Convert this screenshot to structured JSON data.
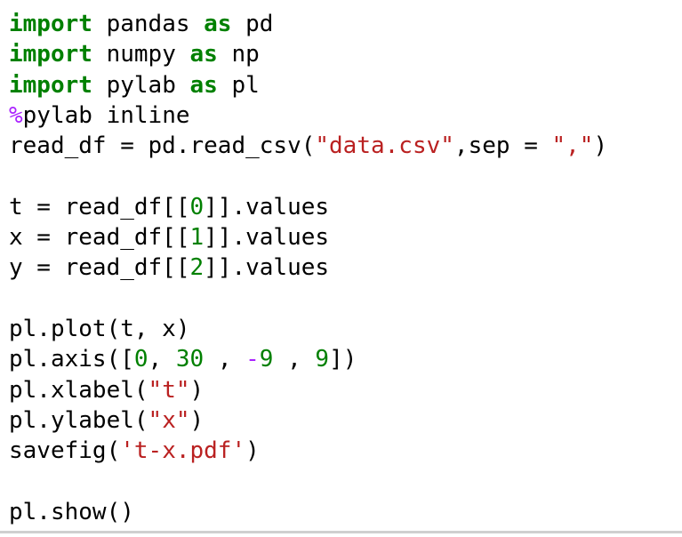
{
  "colors": {
    "keyword": "#008000",
    "magic": "#aa22ff",
    "string": "#ba2121",
    "number": "#008000",
    "operator": "#aa22ff",
    "text": "#000000",
    "background": "#ffffff"
  },
  "code_lines": [
    [
      {
        "t": "import",
        "k": "keyword"
      },
      {
        "t": " pandas ",
        "k": "plain"
      },
      {
        "t": "as",
        "k": "keyword"
      },
      {
        "t": " pd",
        "k": "plain"
      }
    ],
    [
      {
        "t": "import",
        "k": "keyword"
      },
      {
        "t": " numpy ",
        "k": "plain"
      },
      {
        "t": "as",
        "k": "keyword"
      },
      {
        "t": " np",
        "k": "plain"
      }
    ],
    [
      {
        "t": "import",
        "k": "keyword"
      },
      {
        "t": " pylab ",
        "k": "plain"
      },
      {
        "t": "as",
        "k": "keyword"
      },
      {
        "t": " pl",
        "k": "plain"
      }
    ],
    [
      {
        "t": "%",
        "k": "magic"
      },
      {
        "t": "pylab inline",
        "k": "plain"
      }
    ],
    [
      {
        "t": "read_df = pd.read_csv(",
        "k": "plain"
      },
      {
        "t": "\"data.csv\"",
        "k": "string"
      },
      {
        "t": ",sep = ",
        "k": "plain"
      },
      {
        "t": "\",\"",
        "k": "string"
      },
      {
        "t": ")",
        "k": "plain"
      }
    ],
    [],
    [
      {
        "t": "t = read_df[[",
        "k": "plain"
      },
      {
        "t": "0",
        "k": "number"
      },
      {
        "t": "]].values",
        "k": "plain"
      }
    ],
    [
      {
        "t": "x = read_df[[",
        "k": "plain"
      },
      {
        "t": "1",
        "k": "number"
      },
      {
        "t": "]].values",
        "k": "plain"
      }
    ],
    [
      {
        "t": "y = read_df[[",
        "k": "plain"
      },
      {
        "t": "2",
        "k": "number"
      },
      {
        "t": "]].values",
        "k": "plain"
      }
    ],
    [],
    [
      {
        "t": "pl.plot(t, x)",
        "k": "plain"
      }
    ],
    [
      {
        "t": "pl.axis([",
        "k": "plain"
      },
      {
        "t": "0",
        "k": "number"
      },
      {
        "t": ", ",
        "k": "plain"
      },
      {
        "t": "30",
        "k": "number"
      },
      {
        "t": " , ",
        "k": "plain"
      },
      {
        "t": "-",
        "k": "operator"
      },
      {
        "t": "9",
        "k": "number"
      },
      {
        "t": " , ",
        "k": "plain"
      },
      {
        "t": "9",
        "k": "number"
      },
      {
        "t": "])",
        "k": "plain"
      }
    ],
    [
      {
        "t": "pl.xlabel(",
        "k": "plain"
      },
      {
        "t": "\"t\"",
        "k": "string"
      },
      {
        "t": ")",
        "k": "plain"
      }
    ],
    [
      {
        "t": "pl.ylabel(",
        "k": "plain"
      },
      {
        "t": "\"x\"",
        "k": "string"
      },
      {
        "t": ")",
        "k": "plain"
      }
    ],
    [
      {
        "t": "savefig(",
        "k": "plain"
      },
      {
        "t": "'t-x.pdf'",
        "k": "string"
      },
      {
        "t": ")",
        "k": "plain"
      }
    ],
    [],
    [
      {
        "t": "pl.show()",
        "k": "plain"
      }
    ]
  ]
}
